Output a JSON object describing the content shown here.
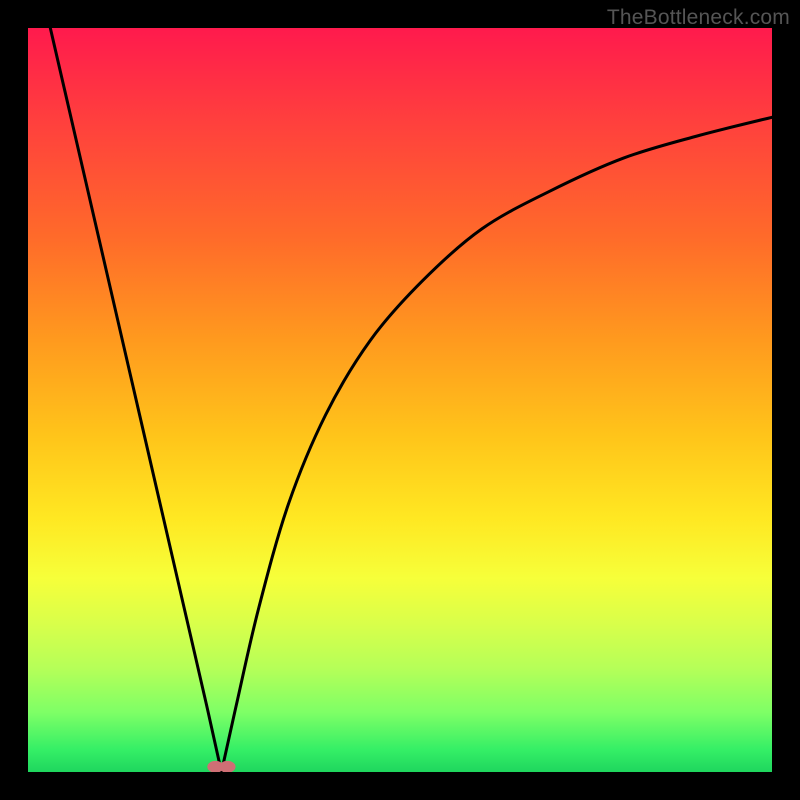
{
  "watermark": {
    "text": "TheBottleneck.com"
  },
  "colors": {
    "frame": "#000000",
    "curve_stroke": "#000000",
    "marker_fill": "#cf6f75",
    "gradient_top": "#ff1a4d",
    "gradient_bottom": "#1fd65e"
  },
  "chart_data": {
    "type": "line",
    "title": "",
    "xlabel": "",
    "ylabel": "",
    "xlim": [
      0,
      100
    ],
    "ylim": [
      0,
      100
    ],
    "series": [
      {
        "name": "left-branch",
        "x": [
          3,
          6,
          9,
          12,
          15,
          18,
          21,
          24,
          26
        ],
        "values": [
          100,
          87,
          74,
          61,
          48,
          35,
          22,
          9,
          0
        ]
      },
      {
        "name": "right-branch",
        "x": [
          26,
          28,
          31,
          35,
          40,
          46,
          53,
          61,
          70,
          80,
          90,
          100
        ],
        "values": [
          0,
          9,
          22,
          36,
          48,
          58,
          66,
          73,
          78,
          82.5,
          85.5,
          88
        ]
      }
    ],
    "markers": [
      {
        "x": 25.2,
        "y": 0.7,
        "r": 1.0
      },
      {
        "x": 26.8,
        "y": 0.7,
        "r": 1.0
      }
    ],
    "annotations": []
  }
}
